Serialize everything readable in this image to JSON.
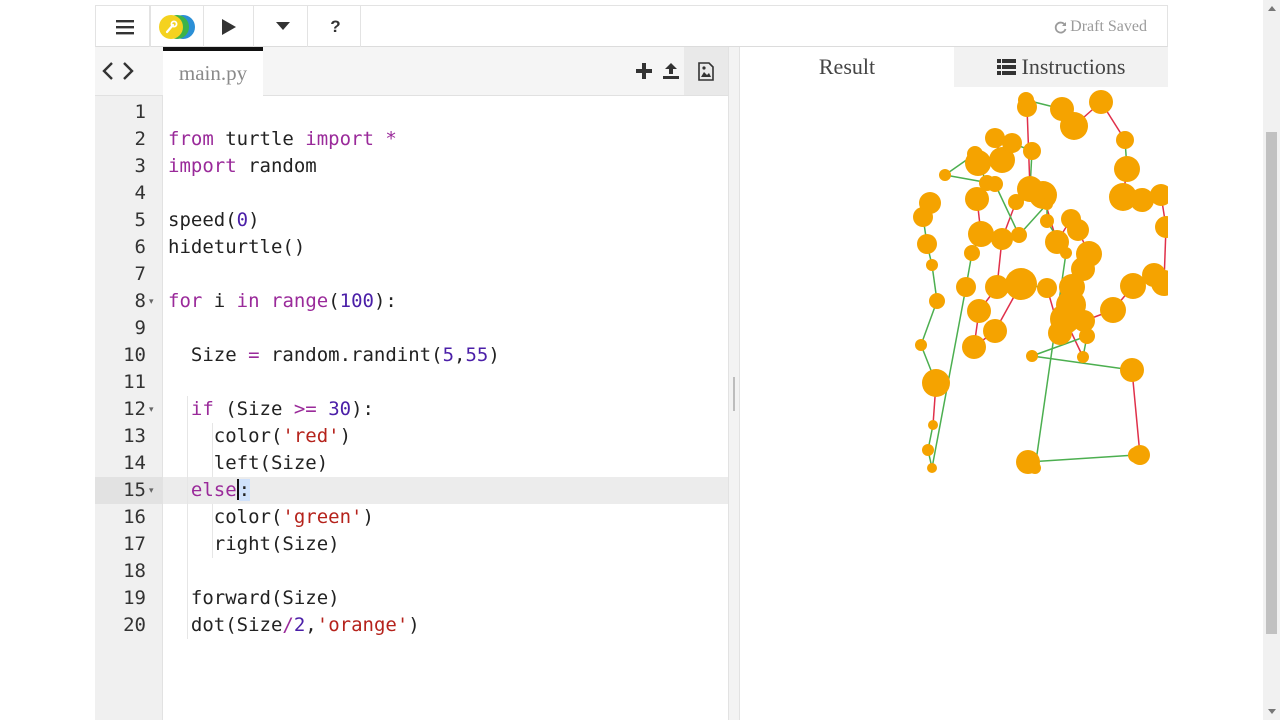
{
  "toolbar": {
    "menu_icon": "hamburger-menu-icon",
    "logo_icon": "trinket-logo-icon",
    "run_icon": "play-icon",
    "dropdown_icon": "caret-down-icon",
    "help_label": "?",
    "status_text": "Draft Saved",
    "status_icon": "refresh-icon"
  },
  "editor": {
    "filename": "main.py",
    "active_line": 15,
    "line_numbers": [
      "1",
      "2",
      "3",
      "4",
      "5",
      "6",
      "7",
      "8",
      "9",
      "10",
      "11",
      "12",
      "13",
      "14",
      "15",
      "16",
      "17",
      "18",
      "19",
      "20"
    ],
    "code_lines": [
      "",
      "from turtle import *",
      "import random",
      "",
      "speed(0)",
      "hideturtle()",
      "",
      "for i in range(100):",
      "",
      "  Size = random.randint(5,55)",
      "",
      "  if (Size >= 30):",
      "    color('red')",
      "    left(Size)",
      "  else:",
      "    color('green')",
      "    right(Size)",
      "",
      "  forward(Size)",
      "  dot(Size/2,'orange')"
    ]
  },
  "result_tabs": {
    "result_label": "Result",
    "instructions_label": "Instructions",
    "instructions_icon": "list-icon"
  },
  "colors": {
    "dot": "#f5a300",
    "red_line": "#e0304a",
    "green_line": "#4caf50",
    "keyword": "#9a2a9a",
    "number": "#4b1fa8",
    "string": "#b5221b"
  }
}
